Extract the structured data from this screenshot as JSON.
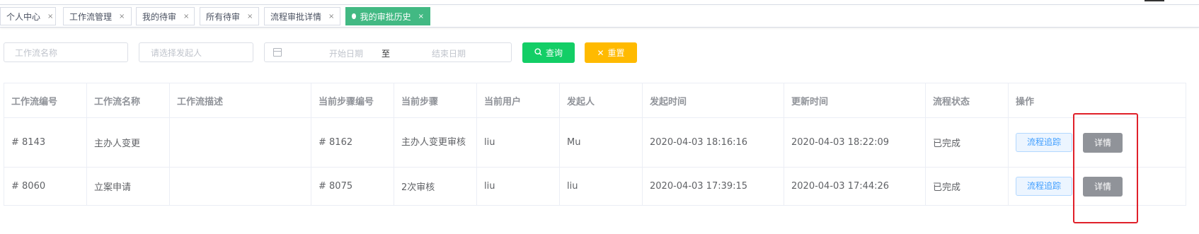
{
  "tags": [
    {
      "label": "个人中心",
      "close": "×",
      "active": false
    },
    {
      "label": "工作流管理",
      "close": "×",
      "active": false
    },
    {
      "label": "我的待审",
      "close": "×",
      "active": false
    },
    {
      "label": "所有待审",
      "close": "×",
      "active": false
    },
    {
      "label": "流程审批详情",
      "close": "×",
      "active": false
    },
    {
      "label": "我的审批历史",
      "close": "×",
      "active": true
    }
  ],
  "filters": {
    "workflow_name_placeholder": "工作流名称",
    "initiator_placeholder": "请选择发起人",
    "start_date_placeholder": "开始日期",
    "range_separator": "至",
    "end_date_placeholder": "结束日期",
    "query_label": "查询",
    "reset_label": "重置"
  },
  "table": {
    "headers": [
      "工作流编号",
      "工作流名称",
      "工作流描述",
      "当前步骤编号",
      "当前步骤",
      "当前用户",
      "发起人",
      "发起时间",
      "更新时间",
      "流程状态",
      "操作"
    ],
    "rows": [
      {
        "id": "# 8143",
        "name": "主办人变更",
        "desc": "",
        "step_id": "# 8162",
        "step": "主办人变更审核",
        "current_user": "liu",
        "initiator": "Mu",
        "start_time": "2020-04-03 18:16:16",
        "update_time": "2020-04-03 18:22:09",
        "status": "已完成",
        "trace_label": "流程追踪",
        "detail_label": "详情"
      },
      {
        "id": "# 8060",
        "name": "立案申请",
        "desc": "",
        "step_id": "# 8075",
        "step": "2次审核",
        "current_user": "liu",
        "initiator": "liu",
        "start_time": "2020-04-03 17:39:15",
        "update_time": "2020-04-03 17:44:26",
        "status": "已完成",
        "trace_label": "流程追踪",
        "detail_label": "详情"
      }
    ]
  },
  "colors": {
    "active_tag": "#42b983",
    "query_button": "#13ce66",
    "reset_button": "#ffba00",
    "detail_button": "#909399",
    "highlight": "#e0202a"
  }
}
